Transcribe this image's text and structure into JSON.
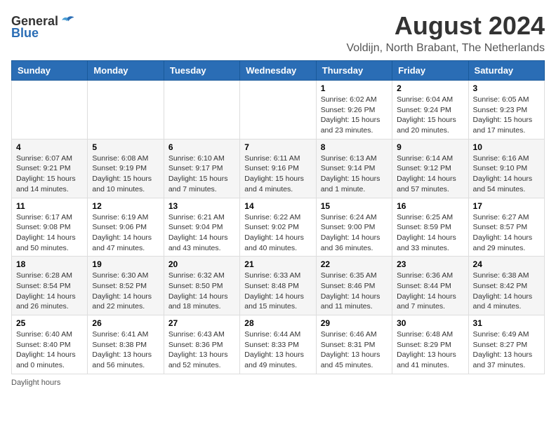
{
  "header": {
    "logo_general": "General",
    "logo_blue": "Blue",
    "title": "August 2024",
    "subtitle": "Voldijn, North Brabant, The Netherlands"
  },
  "weekdays": [
    "Sunday",
    "Monday",
    "Tuesday",
    "Wednesday",
    "Thursday",
    "Friday",
    "Saturday"
  ],
  "weeks": [
    [
      {
        "day": "",
        "info": ""
      },
      {
        "day": "",
        "info": ""
      },
      {
        "day": "",
        "info": ""
      },
      {
        "day": "",
        "info": ""
      },
      {
        "day": "1",
        "info": "Sunrise: 6:02 AM\nSunset: 9:26 PM\nDaylight: 15 hours\nand 23 minutes."
      },
      {
        "day": "2",
        "info": "Sunrise: 6:04 AM\nSunset: 9:24 PM\nDaylight: 15 hours\nand 20 minutes."
      },
      {
        "day": "3",
        "info": "Sunrise: 6:05 AM\nSunset: 9:23 PM\nDaylight: 15 hours\nand 17 minutes."
      }
    ],
    [
      {
        "day": "4",
        "info": "Sunrise: 6:07 AM\nSunset: 9:21 PM\nDaylight: 15 hours\nand 14 minutes."
      },
      {
        "day": "5",
        "info": "Sunrise: 6:08 AM\nSunset: 9:19 PM\nDaylight: 15 hours\nand 10 minutes."
      },
      {
        "day": "6",
        "info": "Sunrise: 6:10 AM\nSunset: 9:17 PM\nDaylight: 15 hours\nand 7 minutes."
      },
      {
        "day": "7",
        "info": "Sunrise: 6:11 AM\nSunset: 9:16 PM\nDaylight: 15 hours\nand 4 minutes."
      },
      {
        "day": "8",
        "info": "Sunrise: 6:13 AM\nSunset: 9:14 PM\nDaylight: 15 hours\nand 1 minute."
      },
      {
        "day": "9",
        "info": "Sunrise: 6:14 AM\nSunset: 9:12 PM\nDaylight: 14 hours\nand 57 minutes."
      },
      {
        "day": "10",
        "info": "Sunrise: 6:16 AM\nSunset: 9:10 PM\nDaylight: 14 hours\nand 54 minutes."
      }
    ],
    [
      {
        "day": "11",
        "info": "Sunrise: 6:17 AM\nSunset: 9:08 PM\nDaylight: 14 hours\nand 50 minutes."
      },
      {
        "day": "12",
        "info": "Sunrise: 6:19 AM\nSunset: 9:06 PM\nDaylight: 14 hours\nand 47 minutes."
      },
      {
        "day": "13",
        "info": "Sunrise: 6:21 AM\nSunset: 9:04 PM\nDaylight: 14 hours\nand 43 minutes."
      },
      {
        "day": "14",
        "info": "Sunrise: 6:22 AM\nSunset: 9:02 PM\nDaylight: 14 hours\nand 40 minutes."
      },
      {
        "day": "15",
        "info": "Sunrise: 6:24 AM\nSunset: 9:00 PM\nDaylight: 14 hours\nand 36 minutes."
      },
      {
        "day": "16",
        "info": "Sunrise: 6:25 AM\nSunset: 8:59 PM\nDaylight: 14 hours\nand 33 minutes."
      },
      {
        "day": "17",
        "info": "Sunrise: 6:27 AM\nSunset: 8:57 PM\nDaylight: 14 hours\nand 29 minutes."
      }
    ],
    [
      {
        "day": "18",
        "info": "Sunrise: 6:28 AM\nSunset: 8:54 PM\nDaylight: 14 hours\nand 26 minutes."
      },
      {
        "day": "19",
        "info": "Sunrise: 6:30 AM\nSunset: 8:52 PM\nDaylight: 14 hours\nand 22 minutes."
      },
      {
        "day": "20",
        "info": "Sunrise: 6:32 AM\nSunset: 8:50 PM\nDaylight: 14 hours\nand 18 minutes."
      },
      {
        "day": "21",
        "info": "Sunrise: 6:33 AM\nSunset: 8:48 PM\nDaylight: 14 hours\nand 15 minutes."
      },
      {
        "day": "22",
        "info": "Sunrise: 6:35 AM\nSunset: 8:46 PM\nDaylight: 14 hours\nand 11 minutes."
      },
      {
        "day": "23",
        "info": "Sunrise: 6:36 AM\nSunset: 8:44 PM\nDaylight: 14 hours\nand 7 minutes."
      },
      {
        "day": "24",
        "info": "Sunrise: 6:38 AM\nSunset: 8:42 PM\nDaylight: 14 hours\nand 4 minutes."
      }
    ],
    [
      {
        "day": "25",
        "info": "Sunrise: 6:40 AM\nSunset: 8:40 PM\nDaylight: 14 hours\nand 0 minutes."
      },
      {
        "day": "26",
        "info": "Sunrise: 6:41 AM\nSunset: 8:38 PM\nDaylight: 13 hours\nand 56 minutes."
      },
      {
        "day": "27",
        "info": "Sunrise: 6:43 AM\nSunset: 8:36 PM\nDaylight: 13 hours\nand 52 minutes."
      },
      {
        "day": "28",
        "info": "Sunrise: 6:44 AM\nSunset: 8:33 PM\nDaylight: 13 hours\nand 49 minutes."
      },
      {
        "day": "29",
        "info": "Sunrise: 6:46 AM\nSunset: 8:31 PM\nDaylight: 13 hours\nand 45 minutes."
      },
      {
        "day": "30",
        "info": "Sunrise: 6:48 AM\nSunset: 8:29 PM\nDaylight: 13 hours\nand 41 minutes."
      },
      {
        "day": "31",
        "info": "Sunrise: 6:49 AM\nSunset: 8:27 PM\nDaylight: 13 hours\nand 37 minutes."
      }
    ]
  ],
  "footer": "Daylight hours"
}
